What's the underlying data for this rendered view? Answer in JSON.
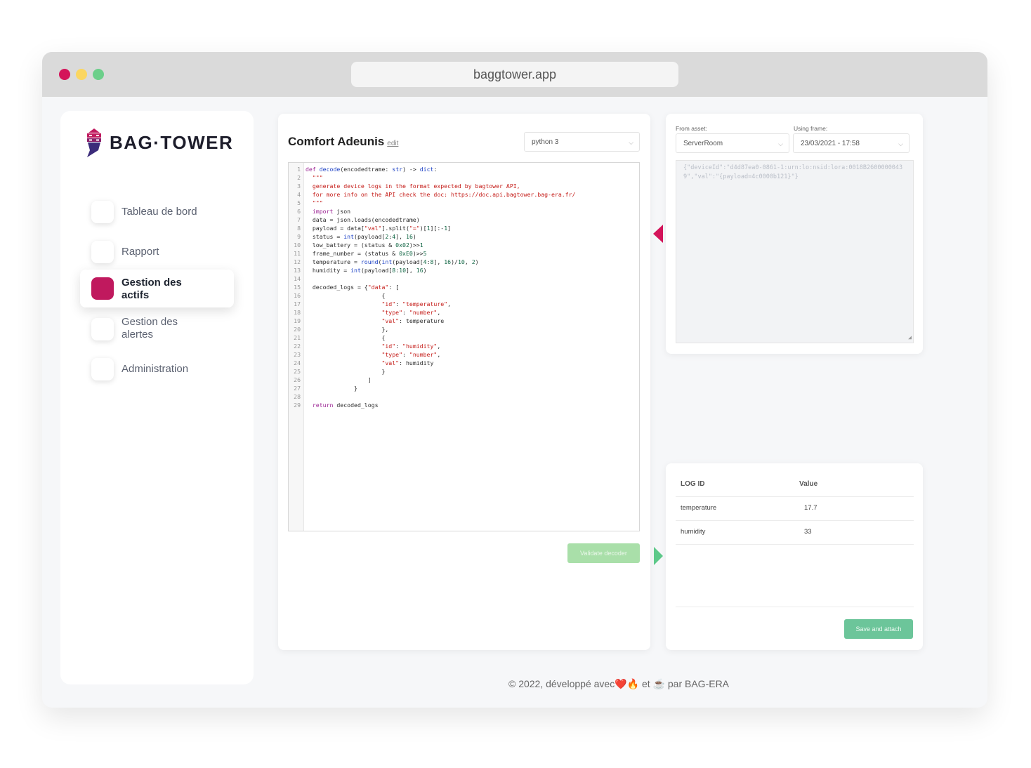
{
  "browser": {
    "url": "baggtower.app"
  },
  "logo": {
    "text": "BAG·TOWER"
  },
  "sidebar": {
    "items": [
      {
        "label": "Tableau de bord",
        "active": false
      },
      {
        "label": "Rapport",
        "active": false
      },
      {
        "label": "Gestion des actifs",
        "active": true
      },
      {
        "label": "Gestion des alertes",
        "active": false
      },
      {
        "label": "Administration",
        "active": false
      }
    ]
  },
  "decoder": {
    "title": "Comfort Adeunis",
    "edit_label": "edit",
    "language": "python 3",
    "validate_label": "Validate decoder",
    "code_lines": [
      "def decode(encodedtrame: str) -> dict:",
      "  \"\"\"",
      "  generate device logs in the format expected by bagtower API,",
      "  for more info on the API check the doc: https://doc.api.bagtower.bag-era.fr/",
      "  \"\"\"",
      "  import json",
      "  data = json.loads(encodedtrame)",
      "  payload = data[\"val\"].split(\"=\")[1][:-1]",
      "  status = int(payload[2:4], 16)",
      "  low_battery = (status & 0x02)>>1",
      "  frame_number = (status & 0xE0)>>5",
      "  temperature = round(int(payload[4:8], 16)/10, 2)",
      "  humidity = int(payload[8:10], 16)",
      "",
      "  decoded_logs = {\"data\": [",
      "                      {",
      "                      \"id\": \"temperature\",",
      "                      \"type\": \"number\",",
      "                      \"val\": temperature",
      "                      },",
      "                      {",
      "                      \"id\": \"humidity\",",
      "                      \"type\": \"number\",",
      "                      \"val\": humidity",
      "                      }",
      "                  ]",
      "              }",
      "",
      "  return decoded_logs"
    ]
  },
  "source": {
    "asset_label": "From asset:",
    "asset_value": "ServerRoom",
    "frame_label": "Using frame:",
    "frame_value": "23/03/2021 - 17:58",
    "frame_text": "{\"deviceId\":\"d4d87ea0-0861-1:urn:lo:nsid:lora:0018B26000000439\",\"val\":\"{payload=4c0000b121}\"}"
  },
  "results": {
    "headers": [
      "LOG ID",
      "Value"
    ],
    "rows": [
      {
        "id": "temperature",
        "value": "17.7"
      },
      {
        "id": "humidity",
        "value": "33"
      }
    ],
    "save_label": "Save and attach"
  },
  "footer": {
    "prefix": "© 2022, développé  avec",
    "emojis": "❤️🔥",
    "middle": "et",
    "cup": "☕",
    "suffix": "par BAG-ERA"
  },
  "colors": {
    "accent": "#c0195e",
    "success": "#6cc59a",
    "arrow_left": "#d4145a",
    "arrow_right": "#5ec98a"
  }
}
